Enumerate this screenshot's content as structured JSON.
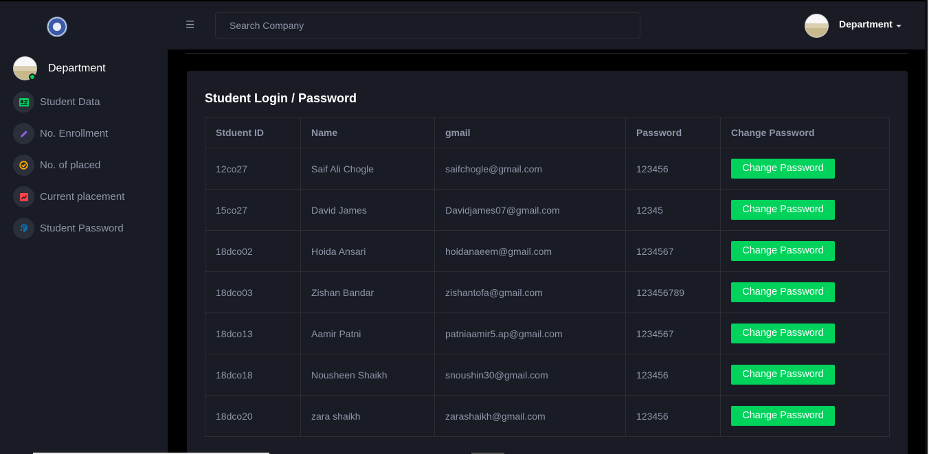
{
  "header": {
    "logo_icon": "college-logo-icon",
    "menu_icon": "hamburger-icon",
    "search_placeholder": "Search Company",
    "user_label": "Department",
    "caret_icon": "caret-down-icon"
  },
  "sidebar": {
    "profile_name": "Department",
    "status_color": "#00d25b",
    "items": [
      {
        "label": "Student Data",
        "icon": "id-card-icon",
        "color": "#00d25b"
      },
      {
        "label": "No. Enrollment",
        "icon": "pencil-icon",
        "color": "#8f5fe8"
      },
      {
        "label": "No. of placed",
        "icon": "check-circle-icon",
        "color": "#ffab00"
      },
      {
        "label": "Current placement",
        "icon": "chart-box-icon",
        "color": "#fc424a"
      },
      {
        "label": "Student Password",
        "icon": "fingerprint-icon",
        "color": "#0090e7"
      }
    ]
  },
  "card": {
    "title": "Student Login / Password",
    "columns": [
      "Stduent ID",
      "Name",
      "gmail",
      "Password",
      "Change Password"
    ],
    "rows": [
      {
        "id": "12co27",
        "name": "Saif Ali Chogle",
        "gmail": "saifchogle@gmail.com",
        "password": "123456",
        "action": "Change Password"
      },
      {
        "id": "15co27",
        "name": "David James",
        "gmail": "Davidjames07@gmail.com",
        "password": "12345",
        "action": "Change Password"
      },
      {
        "id": "18dco02",
        "name": "Hoida Ansari",
        "gmail": "hoidanaeem@gmail.com",
        "password": "1234567",
        "action": "Change Password"
      },
      {
        "id": "18dco03",
        "name": "Zishan Bandar",
        "gmail": "zishantofa@gmail.com",
        "password": "123456789",
        "action": "Change Password"
      },
      {
        "id": "18dco13",
        "name": "Aamir Patni",
        "gmail": "patniaamir5.ap@gmail.com",
        "password": "1234567",
        "action": "Change Password"
      },
      {
        "id": "18dco18",
        "name": "Nousheen Shaikh",
        "gmail": "snoushin30@gmail.com",
        "password": "123456",
        "action": "Change Password"
      },
      {
        "id": "18dco20",
        "name": "zara shaikh",
        "gmail": "zarashaikh@gmail.com",
        "password": "123456",
        "action": "Change Password"
      }
    ]
  },
  "colors": {
    "panel": "#191c24",
    "accent_green": "#00d25b",
    "muted_text": "#8f94a8",
    "border": "#2c2e33"
  }
}
